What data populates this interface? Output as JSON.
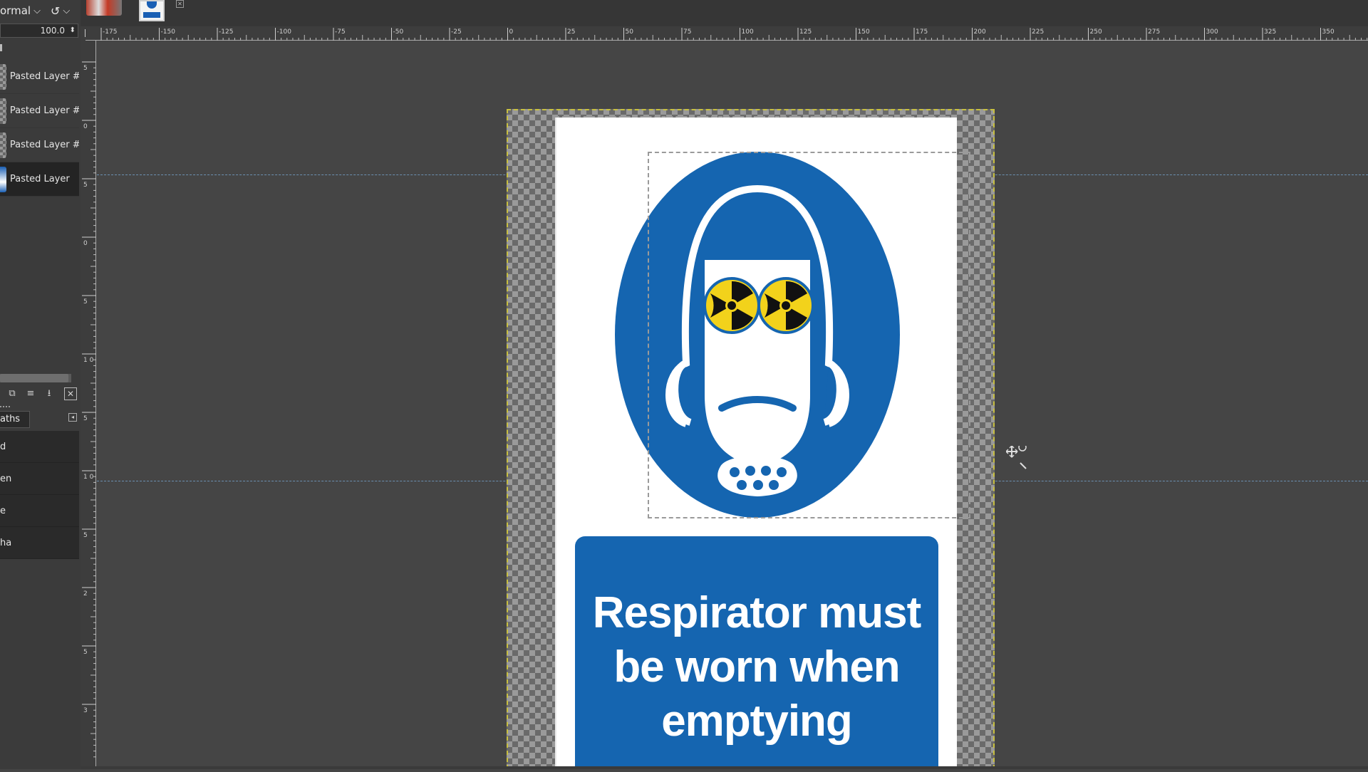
{
  "layers_panel": {
    "mode": "ormal",
    "opacity": "100.0",
    "layers": [
      {
        "name": "Pasted Layer #",
        "active": false
      },
      {
        "name": "Pasted Layer #",
        "active": false
      },
      {
        "name": "Pasted Layer #",
        "active": false
      },
      {
        "name": "Pasted Layer",
        "active": true
      }
    ]
  },
  "paths_panel": {
    "tab_label": "aths",
    "channels": [
      "d",
      "en",
      "e",
      "ha"
    ]
  },
  "rulers": {
    "horizontal": [
      "-175",
      "-150",
      "-125",
      "-100",
      "-75",
      "-50",
      "-25",
      "0",
      "25",
      "50",
      "75",
      "100",
      "125",
      "150",
      "175",
      "200",
      "225",
      "250",
      "275",
      "300",
      "325",
      "350"
    ],
    "vertical": [
      "5",
      "0",
      "5",
      "0",
      "5",
      "1 0 0",
      "5",
      "1 0",
      "5",
      "2",
      "5",
      "3"
    ]
  },
  "canvas": {
    "sign_text": "Respirator must be worn when emptying",
    "colors": {
      "sign_blue": "#1565b0",
      "warning_yellow": "#f2d21b",
      "ui_bg": "#454545"
    }
  },
  "icons": [
    "chevron-down-icon",
    "undo-icon",
    "raise-layer-icon",
    "anchor-icon",
    "merge-icon",
    "delete-icon",
    "move-cursor-icon",
    "respirator-icon",
    "radiation-icon"
  ]
}
